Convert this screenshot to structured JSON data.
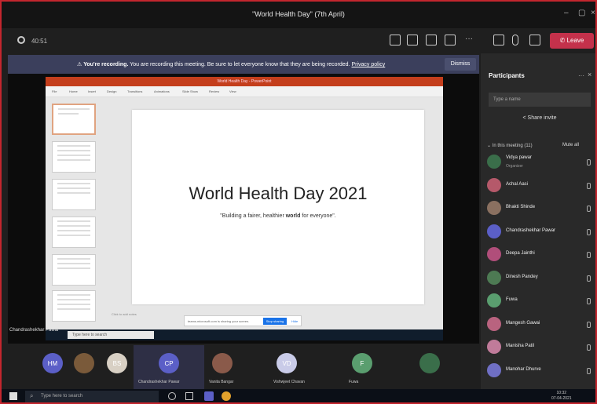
{
  "window": {
    "title": "\"World Health Day\" (7th April)"
  },
  "toolbar": {
    "timer": "40:51",
    "leave_label": "Leave"
  },
  "banner": {
    "bold": "You're recording.",
    "message": "You are recording this meeting. Be sure to let everyone know that they are being recorded.",
    "link": "Privacy policy",
    "dismiss": "Dismiss"
  },
  "presentation": {
    "header": "World Health Day - PowerPoint",
    "ribbon_tabs": [
      "File",
      "Home",
      "Insert",
      "Design",
      "Transitions",
      "Animations",
      "Slide Show",
      "Review",
      "View"
    ],
    "slide_title": "World Health Day 2021",
    "slide_subtitle_pre": "\"Building a fairer, healthier ",
    "slide_subtitle_bold": "world",
    "slide_subtitle_post": " for everyone\".",
    "notes": "Click to add notes",
    "share_message": "teams.microsoft.com is sharing your screen.",
    "stop_sharing": "Stop sharing",
    "hide": "Hide",
    "search_placeholder": "Type here to search",
    "presenter": "Chandrashekhar Pawar"
  },
  "participants_panel": {
    "title": "Participants",
    "search_placeholder": "Type a name",
    "invite": "Share invite",
    "in_meeting": "In this meeting (11)",
    "mute_all": "Mute all",
    "people": [
      {
        "name": "Vidya pawar",
        "role": "Organizer",
        "color": "#3a6e4a"
      },
      {
        "name": "Achal Aasi",
        "role": "",
        "color": "#b5596a"
      },
      {
        "name": "Bhakti Shinde",
        "role": "",
        "color": "#8a7060"
      },
      {
        "name": "Chandrashekhar Pawar",
        "role": "",
        "color": "#5b5fc7"
      },
      {
        "name": "Deepa Jainthi",
        "role": "",
        "color": "#b04e7a"
      },
      {
        "name": "Dinesh Pandey",
        "role": "",
        "color": "#4d7a53"
      },
      {
        "name": "Fuwa",
        "role": "",
        "color": "#5a9e6f"
      },
      {
        "name": "Mangesh Gawai",
        "role": "",
        "color": "#b9637f"
      },
      {
        "name": "Manisha Patil",
        "role": "",
        "color": "#c07b9a"
      },
      {
        "name": "Manohar Dhurve",
        "role": "",
        "color": "#6f6fc4"
      }
    ]
  },
  "gallery": [
    {
      "initials": "HM",
      "name": "",
      "color": "#5b5fc7"
    },
    {
      "initials": "",
      "name": "",
      "color": "#7a5a3a"
    },
    {
      "initials": "BS",
      "name": "",
      "color": "#d8d0c4"
    },
    {
      "initials": "CP",
      "name": "Chandrashekhar Pawar",
      "color": "#5b5fc7"
    },
    {
      "initials": "",
      "name": "Vanita Bangar",
      "color": "#8a5a4a"
    },
    {
      "initials": "VD",
      "name": "Vishwjeet Chavan",
      "color": "#c9cbe8"
    },
    {
      "initials": "F",
      "name": "Fuwa",
      "color": "#5a9e6f"
    },
    {
      "initials": "",
      "name": "",
      "color": "#3a6e4a"
    }
  ],
  "windows_taskbar": {
    "search_placeholder": "Type here to search",
    "time": "10:32",
    "date": "07-04-2021"
  }
}
